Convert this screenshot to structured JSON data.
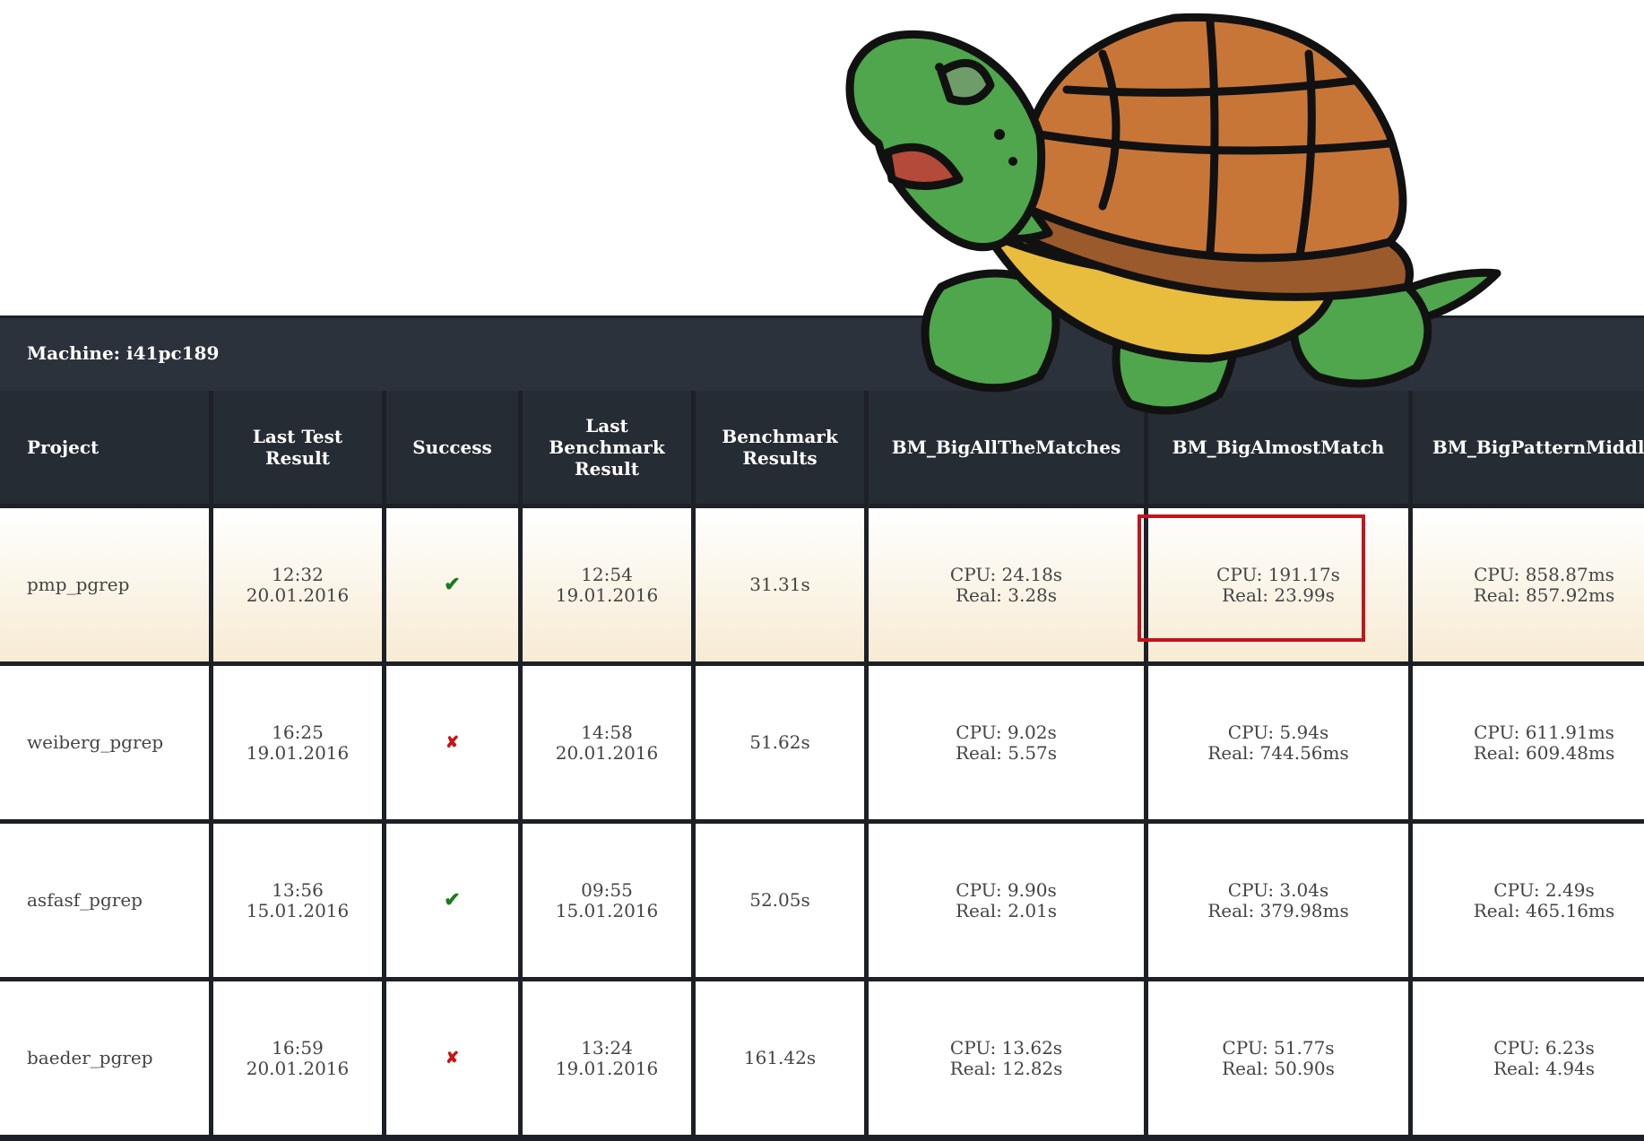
{
  "machine": {
    "label": "Machine: i41pc189"
  },
  "columns": [
    "Project",
    "Last Test Result",
    "Success",
    "Last Benchmark Result",
    "Benchmark Results",
    "BM_BigAllTheMatches",
    "BM_BigAlmostMatch",
    "BM_BigPatternMiddle"
  ],
  "header_lines": {
    "project": "Project",
    "last_test": [
      "Last Test",
      "Result"
    ],
    "success": "Success",
    "last_bench": [
      "Last",
      "Benchmark",
      "Result"
    ],
    "bench_results": [
      "Benchmark",
      "Results"
    ],
    "bm1": "BM_BigAllTheMatches",
    "bm2": "BM_BigAlmostMatch",
    "bm3": "BM_BigPatternMiddle"
  },
  "rows": [
    {
      "project": "pmp_pgrep",
      "last_test_time": "12:32",
      "last_test_date": "20.01.2016",
      "success": true,
      "success_glyph": "✔",
      "last_bench_time": "12:54",
      "last_bench_date": "19.01.2016",
      "bench_results": "31.31s",
      "bm1_cpu": "CPU: 24.18s",
      "bm1_real": "Real: 3.28s",
      "bm2_cpu": "CPU: 191.17s",
      "bm2_real": "Real: 23.99s",
      "bm3_cpu": "CPU: 858.87ms",
      "bm3_real": "Real: 857.92ms",
      "highlighted": true
    },
    {
      "project": "weiberg_pgrep",
      "last_test_time": "16:25",
      "last_test_date": "19.01.2016",
      "success": false,
      "success_glyph": "✘",
      "last_bench_time": "14:58",
      "last_bench_date": "20.01.2016",
      "bench_results": "51.62s",
      "bm1_cpu": "CPU: 9.02s",
      "bm1_real": "Real: 5.57s",
      "bm2_cpu": "CPU: 5.94s",
      "bm2_real": "Real: 744.56ms",
      "bm3_cpu": "CPU: 611.91ms",
      "bm3_real": "Real: 609.48ms",
      "highlighted": false
    },
    {
      "project": "asfasf_pgrep",
      "last_test_time": "13:56",
      "last_test_date": "15.01.2016",
      "success": true,
      "success_glyph": "✔",
      "last_bench_time": "09:55",
      "last_bench_date": "15.01.2016",
      "bench_results": "52.05s",
      "bm1_cpu": "CPU: 9.90s",
      "bm1_real": "Real: 2.01s",
      "bm2_cpu": "CPU: 3.04s",
      "bm2_real": "Real: 379.98ms",
      "bm3_cpu": "CPU: 2.49s",
      "bm3_real": "Real: 465.16ms",
      "highlighted": false
    },
    {
      "project": "baeder_pgrep",
      "last_test_time": "16:59",
      "last_test_date": "20.01.2016",
      "success": false,
      "success_glyph": "✘",
      "last_bench_time": "13:24",
      "last_bench_date": "19.01.2016",
      "bench_results": "161.42s",
      "bm1_cpu": "CPU: 13.62s",
      "bm1_real": "Real: 12.82s",
      "bm2_cpu": "CPU: 51.77s",
      "bm2_real": "Real: 50.90s",
      "bm3_cpu": "CPU: 6.23s",
      "bm3_real": "Real: 4.94s",
      "highlighted": false
    }
  ],
  "colors": {
    "header_bg": "#262c34",
    "grid_lines": "#1d2127",
    "success": "#1c7a1c",
    "failure": "#cc1111",
    "highlight_border": "#c4141c",
    "highlight_row_bottom": "#f7ebd3"
  },
  "images": {
    "mascot": "cartoon-turtle-icon"
  }
}
